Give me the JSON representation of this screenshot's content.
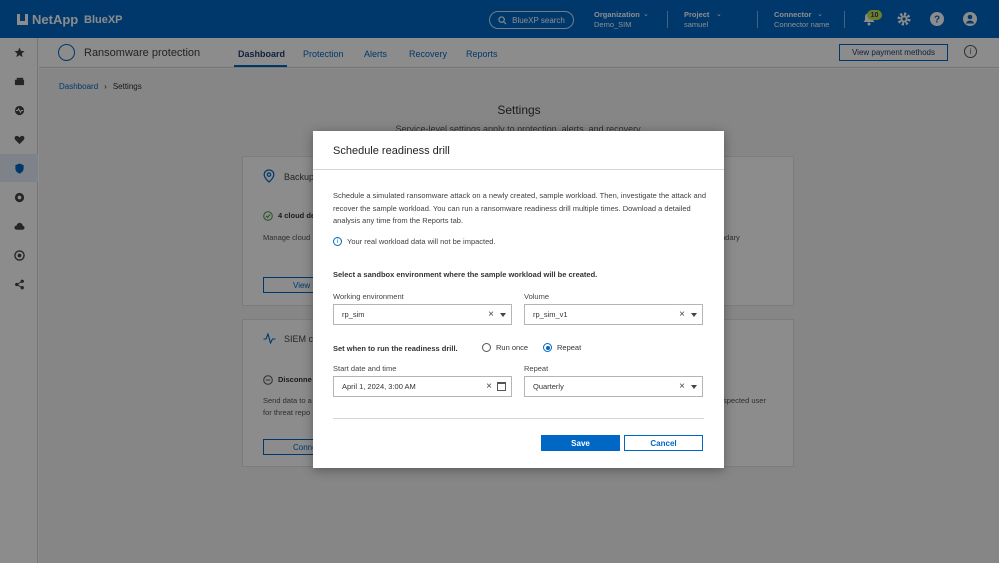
{
  "topbar": {
    "brand": "NetApp",
    "product": "BlueXP",
    "search_label": "BlueXP search",
    "organization": {
      "label": "Organization",
      "value": "Demo_SIM"
    },
    "project": {
      "label": "Project",
      "value": "samuel"
    },
    "connector": {
      "label": "Connector",
      "value": "Connector name"
    },
    "notifications_count": "10",
    "icons": [
      "bell-icon",
      "gear-icon",
      "help-icon",
      "user-icon"
    ]
  },
  "sidebar": {
    "items": [
      {
        "icon": "star-icon"
      },
      {
        "icon": "storage-icon"
      },
      {
        "icon": "health-icon"
      },
      {
        "icon": "heart-icon"
      },
      {
        "icon": "shield-icon",
        "active": true
      },
      {
        "icon": "governance-icon"
      },
      {
        "icon": "cloud-icon"
      },
      {
        "icon": "mobility-icon"
      },
      {
        "icon": "share-icon"
      }
    ]
  },
  "subnav": {
    "service_title": "Ransomware protection",
    "tabs": [
      "Dashboard",
      "Protection",
      "Alerts",
      "Recovery",
      "Reports"
    ],
    "active_tab": "Dashboard",
    "payment_button": "View payment methods"
  },
  "page": {
    "breadcrumb": [
      "Dashboard",
      "Settings"
    ],
    "title": "Settings",
    "subtitle": "Service-level settings apply to protection, alerts, and recovery.",
    "cards": [
      {
        "title": "Backup",
        "status": "4 cloud de",
        "text": "Manage cloud",
        "text_right": "ndary",
        "button": "View"
      },
      {
        "title": "SIEM co",
        "status": "Disconne",
        "text": "Send data to a",
        "text2": "for threat repo",
        "text_right": "spected user",
        "button": "Connec"
      }
    ]
  },
  "modal": {
    "title": "Schedule readiness drill",
    "description": "Schedule a simulated ransomware attack on a newly created, sample workload. Then, investigate the attack and recover the sample workload. You can run a ransomware readiness drill multiple times. Download a detailed analysis any time from the Reports tab.",
    "note": "Your real workload data will not be impacted.",
    "sandbox_heading": "Select a sandbox environment where the sample workload will be created.",
    "working_env_label": "Working environment",
    "working_env_value": "rp_sim",
    "volume_label": "Volume",
    "volume_value": "rp_sim_v1",
    "schedule_heading": "Set when to run the readiness drill.",
    "run_once_label": "Run once",
    "repeat_option_label": "Repeat",
    "selected_schedule": "Repeat",
    "start_label": "Start date and time",
    "start_value": "April 1, 2024, 3:00 AM",
    "repeat_label": "Repeat",
    "repeat_value": "Quarterly",
    "save_button": "Save",
    "cancel_button": "Cancel"
  },
  "colors": {
    "brand_blue": "#0067c5",
    "nav_active": "#1b3e75",
    "badge": "#c8e34d",
    "overlay": "rgba(0,0,0,0.45)"
  }
}
